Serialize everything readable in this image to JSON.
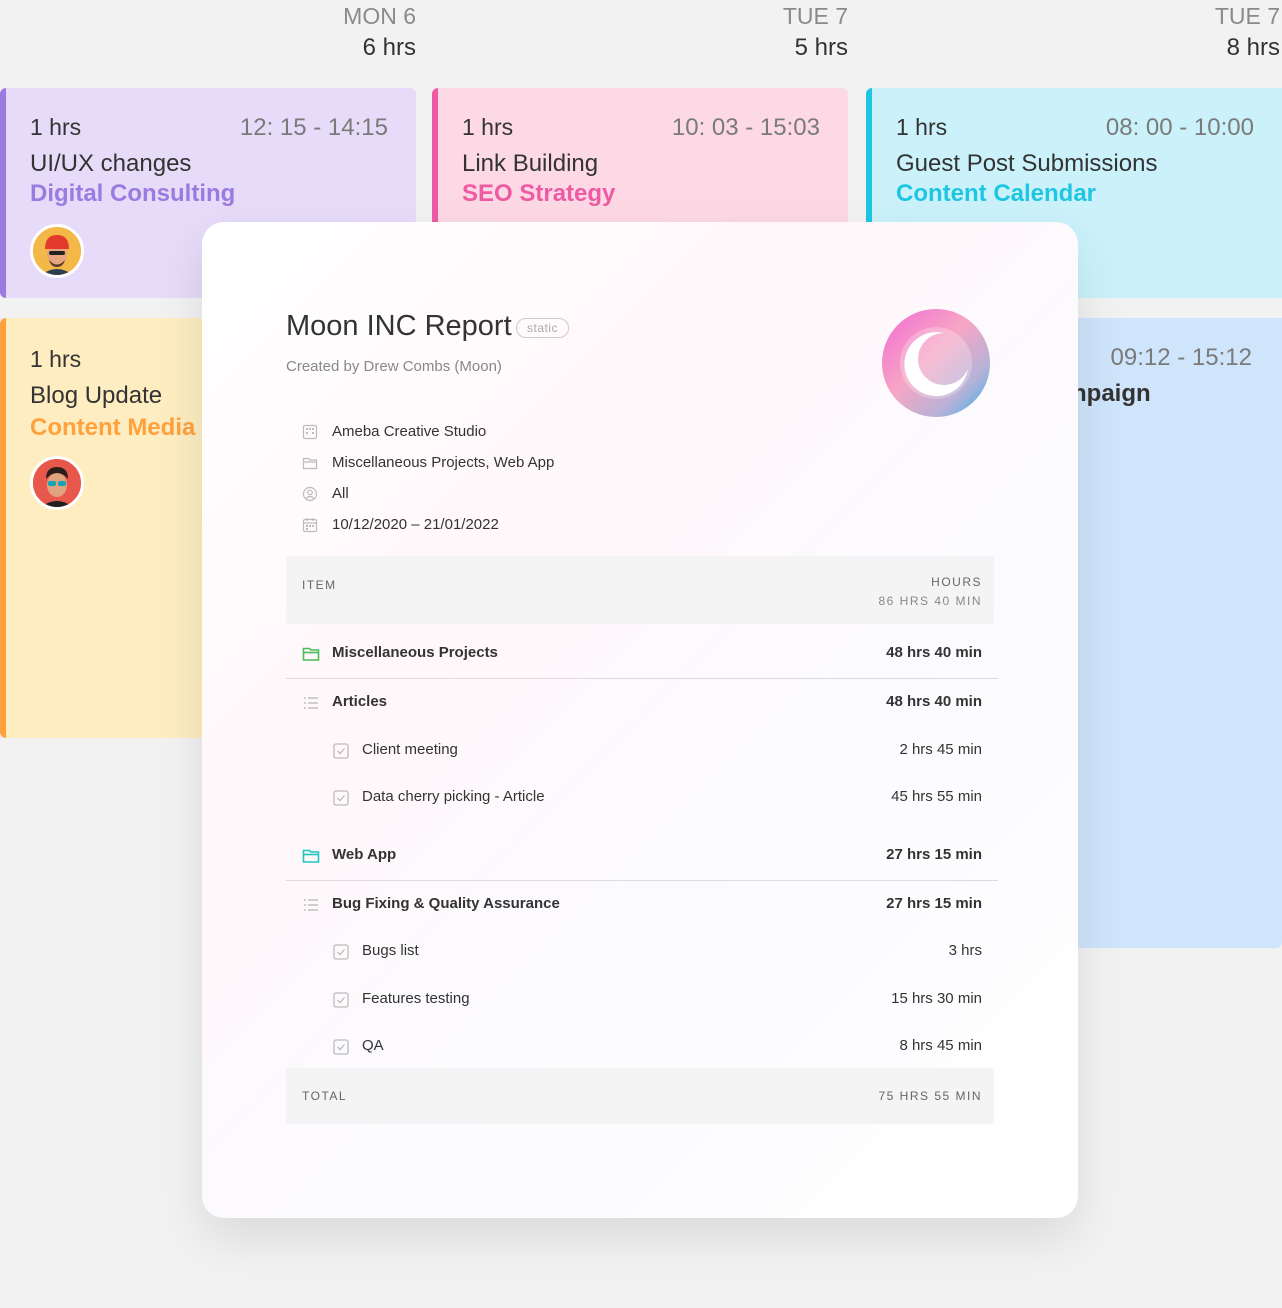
{
  "days": [
    {
      "day": "MON 6",
      "hours": "6 hrs"
    },
    {
      "day": "TUE 7",
      "hours": "5 hrs"
    },
    {
      "day": "TUE 7",
      "hours": "8 hrs"
    }
  ],
  "cards": [
    {
      "hrs": "1 hrs",
      "time": "12: 15 - 14:15",
      "title": "UI/UX changes",
      "subtitle": "Digital Consulting",
      "color": "#9b7be0",
      "bg": "#e6dbf8"
    },
    {
      "hrs": "1 hrs",
      "time": "10: 03 - 15:03",
      "title": "Link Building",
      "subtitle": "SEO Strategy",
      "color": "#ee5aa3",
      "bg": "#fdd9e6"
    },
    {
      "hrs": "1 hrs",
      "time": "08: 00 - 10:00",
      "title": "Guest Post Submissions",
      "subtitle": "Content Calendar",
      "color": "#1ec6e2",
      "bg": "#cbf2fa"
    },
    {
      "hrs": "1 hrs",
      "title": "Blog Update",
      "subtitle": "Content Media",
      "color": "#ffa13d",
      "bg": "#fdedc1"
    },
    {
      "time": "09:12 - 15:12",
      "title": "npaign",
      "color": "#7ab7f0",
      "bg": "#cfe5fb"
    }
  ],
  "report": {
    "title": "Moon INC Report",
    "badge": "static",
    "creator": "Created by Drew Combs (Moon)",
    "meta": [
      {
        "icon": "building-icon",
        "text": "Ameba Creative Studio"
      },
      {
        "icon": "folder-icon",
        "text": "Miscellaneous Projects, Web App"
      },
      {
        "icon": "user-icon",
        "text": "All"
      },
      {
        "icon": "calendar-icon",
        "text": "10/12/2020 – 21/01/2022"
      }
    ],
    "table": {
      "item_header": "ITEM",
      "hours_header": "HOURS",
      "hours_total_header": "86 HRS 40 MIN",
      "rows": [
        {
          "name": "Miscellaneous Projects",
          "value": "48 hrs 40 min"
        },
        {
          "name": "Articles",
          "value": "48 hrs 40 min"
        },
        {
          "name": "Client meeting",
          "value": "2 hrs 45 min"
        },
        {
          "name": "Data cherry picking - Article",
          "value": "45 hrs 55 min"
        },
        {
          "name": "Web App",
          "value": "27 hrs 15 min"
        },
        {
          "name": "Bug Fixing & Quality Assurance",
          "value": "27 hrs 15 min"
        },
        {
          "name": "Bugs list",
          "value": "3 hrs"
        },
        {
          "name": "Features testing",
          "value": "15 hrs 30 min"
        },
        {
          "name": "QA",
          "value": "8 hrs 45 min"
        }
      ],
      "total_label": "TOTAL",
      "total_value": "75 HRS 55 MIN"
    }
  }
}
